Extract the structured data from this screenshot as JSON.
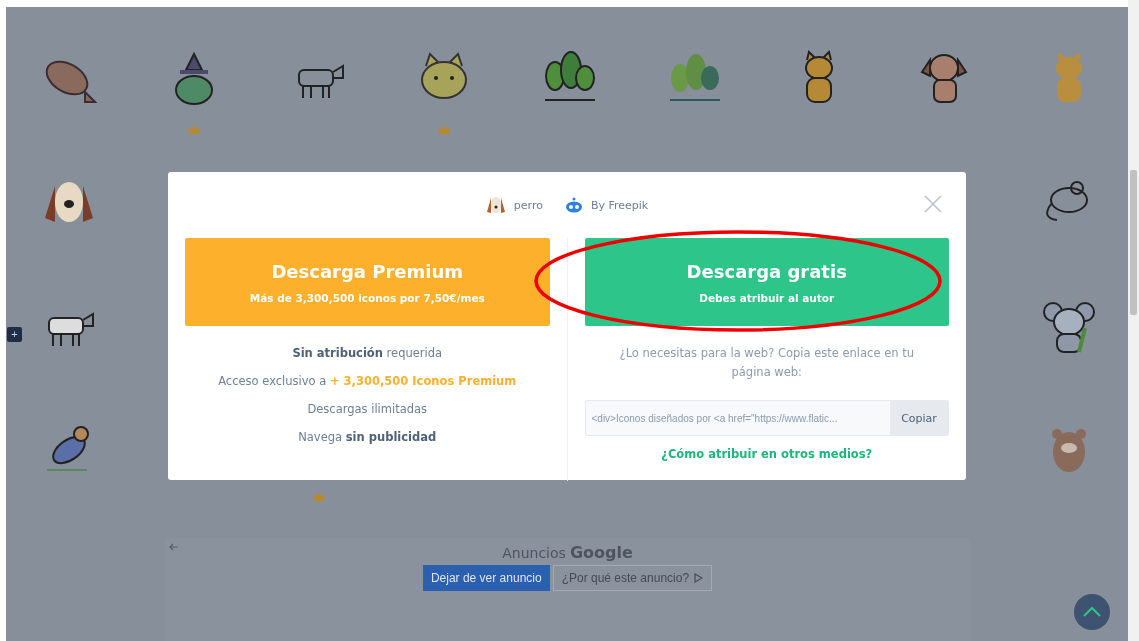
{
  "icon_grid": [
    {
      "premium": false
    },
    {
      "premium": true
    },
    {
      "premium": false
    },
    {
      "premium": true
    },
    {
      "premium": false
    },
    {
      "premium": false
    },
    {
      "premium": false
    },
    {
      "premium": false
    },
    {
      "premium": false
    },
    {
      "premium": false
    },
    {
      "premium": false
    },
    {
      "premium": false
    },
    {
      "premium": false
    },
    {
      "premium": false
    },
    {
      "premium": true
    },
    {
      "premium": false
    }
  ],
  "side_button": "+",
  "modal": {
    "icon_name": "perro",
    "author": "By Freepik",
    "premium": {
      "title": "Descarga Premium",
      "subtitle": "Más de 3,300,500 iconos por 7,50€/mes",
      "features": [
        "**Sin atribución** requerida",
        "Acceso exclusivo a **+ 3,300,500 Iconos Premium**",
        "Descargas ilimitadas",
        "Navega **sin publicidad**"
      ]
    },
    "free": {
      "title": "Descarga gratis",
      "subtitle": "Debes atribuir al autor",
      "hint": "¿Lo necesitas para la web? Copia este enlace en tu página web:",
      "embed_code": "<div>Iconos diseñados por <a href=\"https://www.flatic...",
      "copy_button": "Copiar",
      "link": "¿Cómo atribuir en otros medios?"
    }
  },
  "ad": {
    "label": "Anuncios",
    "brand": "Google",
    "stop_button": "Dejar de ver anuncio",
    "why_button": "¿Por qué este anuncio?"
  }
}
